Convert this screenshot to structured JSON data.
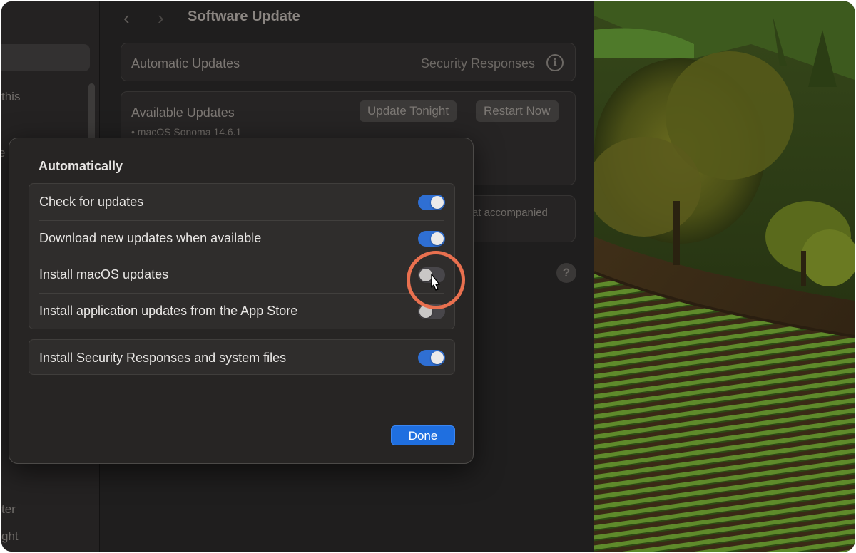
{
  "sidebar": {
    "fragments": [
      "this",
      "e",
      "ter",
      "ght"
    ]
  },
  "toolbar": {
    "back_glyph": "‹",
    "forward_glyph": "›",
    "title": "Software Update"
  },
  "automatic_updates": {
    "label": "Automatic Updates",
    "value": "Security Responses",
    "info_glyph": "i"
  },
  "available_updates": {
    "label": "Available Updates",
    "update_tonight": "Update Tonight",
    "restart_now": "Restart Now",
    "item": "• macOS Sonoma 14.6.1"
  },
  "note_fragment": "at accompanied",
  "help_glyph": "?",
  "sheet": {
    "title": "Automatically",
    "options": [
      {
        "label": "Check for updates",
        "on": true
      },
      {
        "label": "Download new updates when available",
        "on": true
      },
      {
        "label": "Install macOS updates",
        "on": false
      },
      {
        "label": "Install application updates from the App Store",
        "on": false
      }
    ],
    "security_option": {
      "label": "Install Security Responses and system files",
      "on": true
    },
    "done": "Done"
  },
  "colors": {
    "accent": "#2f6fd3",
    "done_button": "#1f6fe0",
    "highlight": "#e9704f"
  }
}
